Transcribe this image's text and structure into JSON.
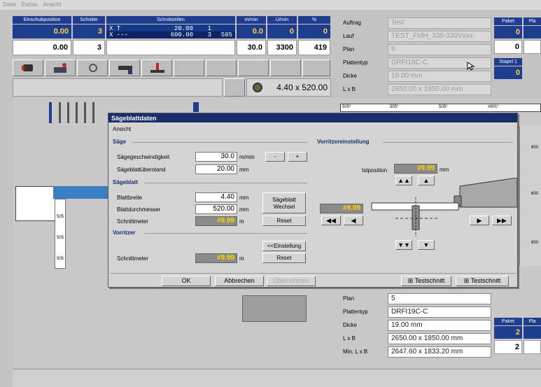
{
  "menu": [
    "Datei",
    "Extras",
    "Ansicht"
  ],
  "top_left": {
    "headers": [
      "Einschubposition",
      "Schnitte",
      "Schnittzeilen",
      "m/min",
      "U/min",
      "%"
    ],
    "row1": {
      "pos": "0.00",
      "cuts": "3",
      "speed": "0.0",
      "rpm": "0",
      "pct": "0"
    },
    "row2": {
      "pos": "0.00",
      "cuts": "3",
      "speed": "30.0",
      "rpm": "3300",
      "pct": "419"
    },
    "lines": [
      {
        "axis": "X T",
        "value": "20.00",
        "n": "1",
        "m": ""
      },
      {
        "axis": "X ---",
        "value": "600.00",
        "n": "3",
        "m": "505"
      }
    ],
    "dimension": "4.40 x 520.00"
  },
  "top_right": {
    "labels": [
      "Auftrag",
      "Lauf",
      "Plan",
      "Plattentyp",
      "Dicke",
      "L x B"
    ],
    "values": [
      "Test",
      "TEST_FMH_330-330Vxxx",
      "5",
      "DRFI19C-C",
      "19.00 mm",
      "2650.00 x 1850.00 mm"
    ],
    "paket_label": "Paket",
    "pl_label": "Pla",
    "paket_top": "0",
    "paket_bottom": "0",
    "stapel_label": "Stapel 1",
    "stapel_value": "0"
  },
  "bottom_right": {
    "labels": [
      "Plan",
      "Plattentyp",
      "Dicke",
      "L x B",
      "Min. L x B"
    ],
    "values": [
      "5",
      "DRFI19C-C",
      "19.00 mm",
      "2650.00 x 1850.00 mm",
      "2647.60 x 1833.20 mm"
    ],
    "paket_label": "Paket",
    "pl_label": "Pla",
    "paket_top": "2",
    "paket_bottom": "2"
  },
  "layout_labels": {
    "tops": [
      "505*",
      "505*",
      "505*",
      "#601*"
    ],
    "sides": [
      "800",
      "800",
      "800"
    ],
    "left": [
      "505",
      "505",
      "505"
    ]
  },
  "dialog": {
    "title": "Sägeblattdaten",
    "menu": "Ansicht",
    "saege": {
      "section": "Säge",
      "speed_label": "Sägegeschwindigkeit",
      "speed_value": "30.0",
      "speed_unit": "m/min",
      "minus": "-",
      "plus": "+",
      "overhang_label": "Sägeblattüberstand",
      "overhang_value": "20.00",
      "overhang_unit": "mm"
    },
    "blade": {
      "section": "Sägeblatt",
      "width_label": "Blattbreite",
      "width_value": "4.40",
      "width_unit": "mm",
      "diameter_label": "Blattdurchmesser",
      "diameter_value": "520.00",
      "diameter_unit": "mm",
      "meter_label": "Schnittmeter",
      "meter_value": "#9.99",
      "meter_unit": "m",
      "change_button": "Sägeblatt Wechsel",
      "reset_button": "Reset"
    },
    "scorer": {
      "section": "Vorritzer",
      "settings_button": "<<Einstellung",
      "meter_label": "Schnittmeter",
      "meter_value": "#9.99",
      "meter_unit": "m",
      "reset_button": "Reset"
    },
    "adjust": {
      "section": "Vorritzereinstellung",
      "ist_label": "Istposition",
      "ist_value": "#9.99",
      "ist_unit": "mm",
      "horiz_value": "#9.99"
    },
    "buttons": {
      "ok": "OK",
      "cancel": "Abbrechen",
      "apply": "Übernehmen",
      "test1": "Testschnitt",
      "test2": "Testschnitt"
    }
  }
}
